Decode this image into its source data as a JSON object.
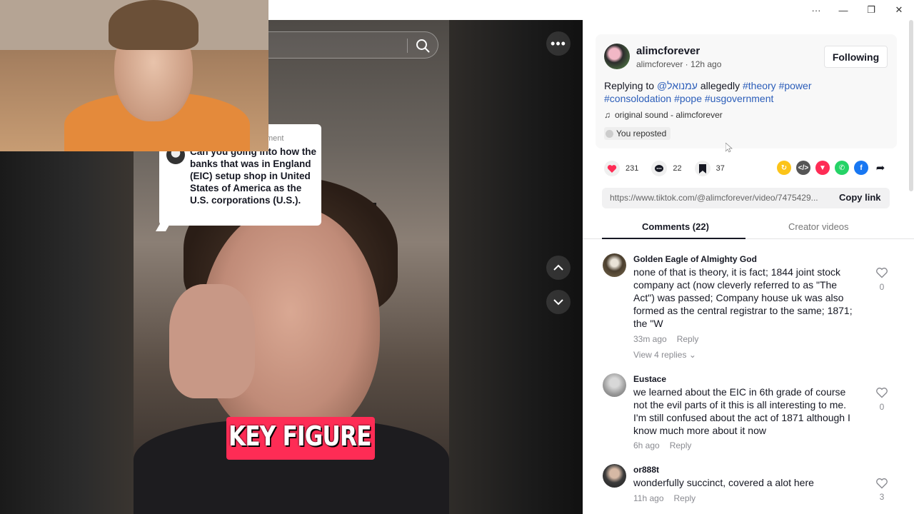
{
  "window": {
    "more": "···",
    "minimize": "—",
    "restore": "❐",
    "close": "✕"
  },
  "video": {
    "reply_label": "ment",
    "reply_text": "Can you going into how the banks that was in England (EIC) setup shop in United States of America as the U.S. corporations (U.S.).",
    "caption": "KEY FIGURE",
    "more": "•••"
  },
  "post": {
    "author": "alimcforever",
    "meta": "alimcforever · 12h ago",
    "follow_label": "Following",
    "desc_prefix": "Replying to ",
    "desc_mention": "@עמנואל",
    "desc_mid": " allegedly ",
    "desc_tags_line1": "#theory #power",
    "desc_tags_line2": "#consolodation #pope #usgovernment",
    "sound": "original sound - alimcforever",
    "repost": "You reposted"
  },
  "actions": {
    "likes": "231",
    "comments": "22",
    "saves": "37"
  },
  "link": {
    "url": "https://www.tiktok.com/@alimcforever/video/7475429...",
    "copy_label": "Copy link"
  },
  "tabs": {
    "comments": "Comments (22)",
    "creator": "Creator videos"
  },
  "comments": [
    {
      "user": "Golden Eagle of Almighty God",
      "text": "none of that is theory, it is fact; 1844 joint stock company act (now cleverly referred to as \"The Act\") was passed; Company house uk was also formed as the central registrar to the same; 1871; the \"W",
      "time": "33m ago",
      "reply": "Reply",
      "replies": "View 4 replies",
      "likes": "0"
    },
    {
      "user": "Eustace",
      "text": "we learned about the EIC in 6th grade of course not the evil parts of it this is all interesting to me. I'm still confused about the act of 1871 although I know much more about it now",
      "time": "6h ago",
      "reply": "Reply",
      "likes": "0"
    },
    {
      "user": "or888t",
      "text": "wonderfully succinct, covered a alot here",
      "time": "11h ago",
      "reply": "Reply",
      "likes": "3"
    }
  ],
  "colors": {
    "accent": "#fe2c55",
    "hashtag": "#2b5db9",
    "caption_bg": "#fe2c55"
  }
}
